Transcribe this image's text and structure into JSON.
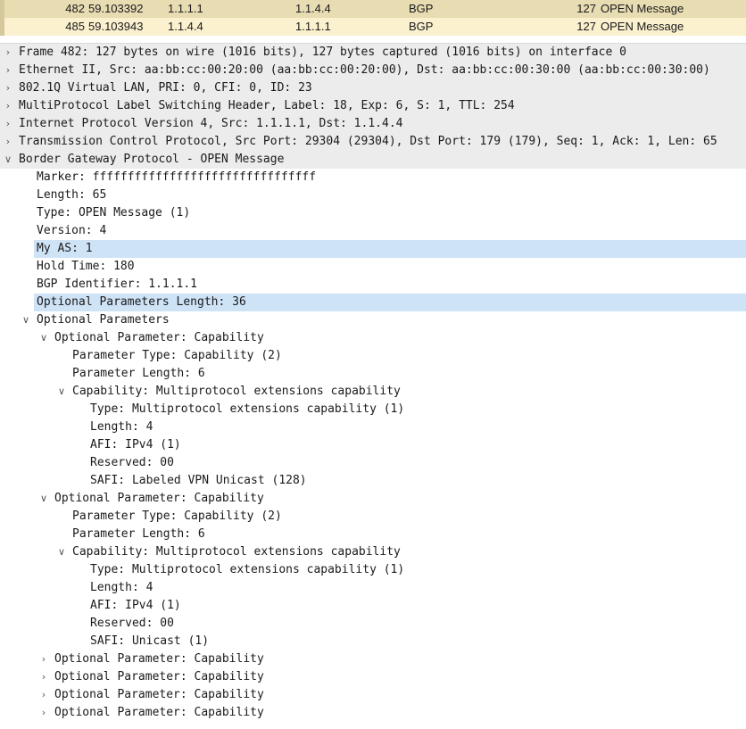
{
  "packet_list": {
    "rows": [
      {
        "no": "482",
        "time": "59.103392",
        "src": "1.1.1.1",
        "dst": "1.1.4.4",
        "proto": "BGP",
        "len": "127",
        "info": "OPEN Message"
      },
      {
        "no": "485",
        "time": "59.103943",
        "src": "1.1.4.4",
        "dst": "1.1.1.1",
        "proto": "BGP",
        "len": "127",
        "info": "OPEN Message"
      }
    ]
  },
  "tree": [
    {
      "level": 0,
      "state": "collapsed",
      "text": "Frame 482: 127 bytes on wire (1016 bits), 127 bytes captured (1016 bits) on interface 0"
    },
    {
      "level": 0,
      "state": "collapsed",
      "text": "Ethernet II, Src: aa:bb:cc:00:20:00 (aa:bb:cc:00:20:00), Dst: aa:bb:cc:00:30:00 (aa:bb:cc:00:30:00)"
    },
    {
      "level": 0,
      "state": "collapsed",
      "text": "802.1Q Virtual LAN, PRI: 0, CFI: 0, ID: 23"
    },
    {
      "level": 0,
      "state": "collapsed",
      "text": "MultiProtocol Label Switching Header, Label: 18, Exp: 6, S: 1, TTL: 254"
    },
    {
      "level": 0,
      "state": "collapsed",
      "text": "Internet Protocol Version 4, Src: 1.1.1.1, Dst: 1.1.4.4"
    },
    {
      "level": 0,
      "state": "collapsed",
      "text": "Transmission Control Protocol, Src Port: 29304 (29304), Dst Port: 179 (179), Seq: 1, Ack: 1, Len: 65"
    },
    {
      "level": 0,
      "state": "expanded",
      "text": "Border Gateway Protocol - OPEN Message"
    },
    {
      "level": 1,
      "state": "leaf",
      "text": "Marker: ffffffffffffffffffffffffffffffff"
    },
    {
      "level": 1,
      "state": "leaf",
      "text": "Length: 65"
    },
    {
      "level": 1,
      "state": "leaf",
      "text": "Type: OPEN Message (1)"
    },
    {
      "level": 1,
      "state": "leaf",
      "text": "Version: 4"
    },
    {
      "level": 1,
      "state": "leaf",
      "text": "My AS: 1",
      "selected": true
    },
    {
      "level": 1,
      "state": "leaf",
      "text": "Hold Time: 180"
    },
    {
      "level": 1,
      "state": "leaf",
      "text": "BGP Identifier: 1.1.1.1"
    },
    {
      "level": 1,
      "state": "leaf",
      "text": "Optional Parameters Length: 36",
      "selected": true
    },
    {
      "level": 1,
      "state": "expanded",
      "text": "Optional Parameters"
    },
    {
      "level": 2,
      "state": "expanded",
      "text": "Optional Parameter: Capability"
    },
    {
      "level": 3,
      "state": "leaf",
      "text": "Parameter Type: Capability (2)"
    },
    {
      "level": 3,
      "state": "leaf",
      "text": "Parameter Length: 6"
    },
    {
      "level": 3,
      "state": "expanded",
      "text": "Capability: Multiprotocol extensions capability"
    },
    {
      "level": 4,
      "state": "leaf",
      "text": "Type: Multiprotocol extensions capability (1)"
    },
    {
      "level": 4,
      "state": "leaf",
      "text": "Length: 4"
    },
    {
      "level": 4,
      "state": "leaf",
      "text": "AFI: IPv4 (1)"
    },
    {
      "level": 4,
      "state": "leaf",
      "text": "Reserved: 00"
    },
    {
      "level": 4,
      "state": "leaf",
      "text": "SAFI: Labeled VPN Unicast (128)"
    },
    {
      "level": 2,
      "state": "expanded",
      "text": "Optional Parameter: Capability"
    },
    {
      "level": 3,
      "state": "leaf",
      "text": "Parameter Type: Capability (2)"
    },
    {
      "level": 3,
      "state": "leaf",
      "text": "Parameter Length: 6"
    },
    {
      "level": 3,
      "state": "expanded",
      "text": "Capability: Multiprotocol extensions capability"
    },
    {
      "level": 4,
      "state": "leaf",
      "text": "Type: Multiprotocol extensions capability (1)"
    },
    {
      "level": 4,
      "state": "leaf",
      "text": "Length: 4"
    },
    {
      "level": 4,
      "state": "leaf",
      "text": "AFI: IPv4 (1)"
    },
    {
      "level": 4,
      "state": "leaf",
      "text": "Reserved: 00"
    },
    {
      "level": 4,
      "state": "leaf",
      "text": "SAFI: Unicast (1)"
    },
    {
      "level": 2,
      "state": "collapsed",
      "text": "Optional Parameter: Capability"
    },
    {
      "level": 2,
      "state": "collapsed",
      "text": "Optional Parameter: Capability"
    },
    {
      "level": 2,
      "state": "collapsed",
      "text": "Optional Parameter: Capability"
    },
    {
      "level": 2,
      "state": "collapsed",
      "text": "Optional Parameter: Capability"
    }
  ],
  "icons": {
    "collapsed": "chevron-right-icon",
    "expanded": "chevron-down-icon"
  },
  "colors": {
    "packet_row_1": "#e8dcb3",
    "packet_row_2": "#fbf1cf",
    "selected_field": "#cfe3f7",
    "top_level_bg": "#ececec"
  }
}
